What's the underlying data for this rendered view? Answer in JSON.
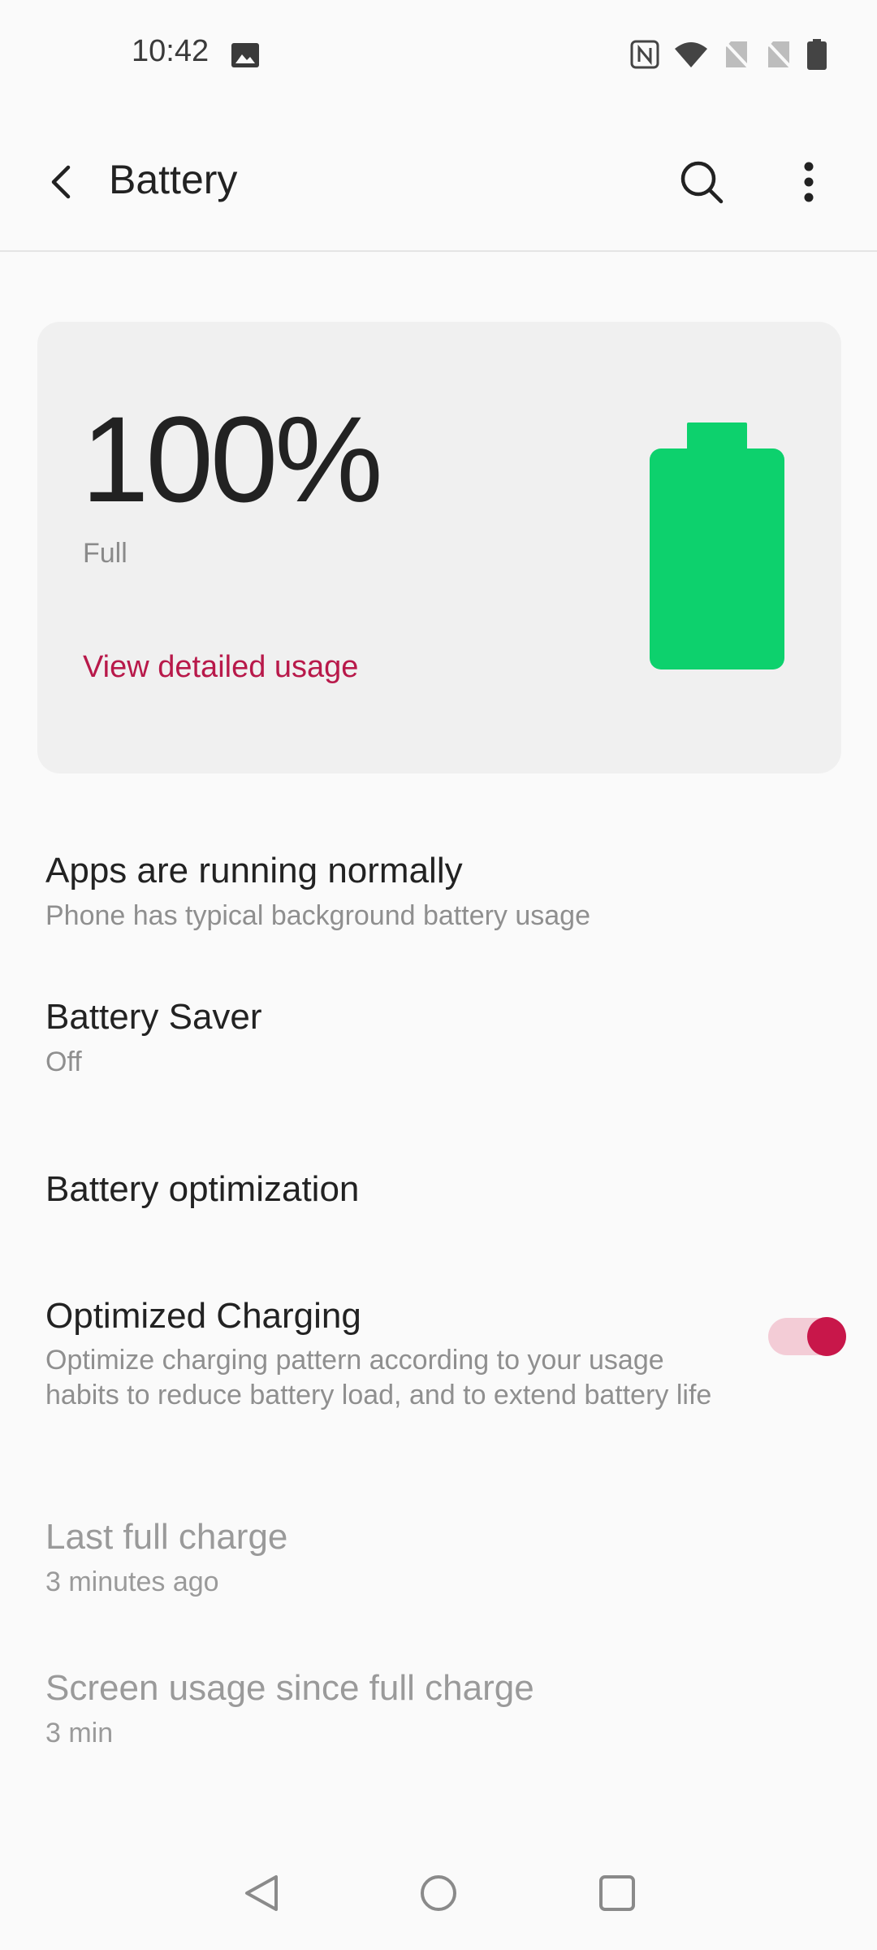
{
  "status_bar": {
    "time": "10:42",
    "left_icons": [
      "image-icon"
    ],
    "right_icons": [
      "nfc-icon",
      "wifi-icon",
      "no-sim-icon",
      "no-sim-icon",
      "battery-icon"
    ]
  },
  "app_bar": {
    "title": "Battery",
    "icons": [
      "back-arrow-icon",
      "search-icon",
      "more-vert-icon"
    ]
  },
  "battery_card": {
    "percent": "100%",
    "status": "Full",
    "link": "View detailed usage",
    "level": 1.0,
    "colors": {
      "battery": "#0dd16d",
      "link": "#b8194a",
      "card": "#f0f0f0"
    }
  },
  "items": {
    "apps_status": {
      "title": "Apps are running normally",
      "subtitle": "Phone has typical background battery usage"
    },
    "battery_saver": {
      "title": "Battery Saver",
      "subtitle": "Off"
    },
    "battery_optimization": {
      "title": "Battery optimization"
    },
    "optimized_charging": {
      "title": "Optimized Charging",
      "subtitle": "Optimize charging pattern according to your usage habits to reduce battery load, and to extend battery life",
      "toggle_on": true,
      "colors": {
        "thumb": "#c8174a",
        "track": "#f3ccd6"
      }
    },
    "last_full_charge": {
      "title": "Last full charge",
      "subtitle": "3 minutes ago"
    },
    "screen_usage": {
      "title": "Screen usage since full charge",
      "subtitle": "3 min"
    }
  },
  "nav_bar": {
    "icons": [
      "back-triangle-icon",
      "home-circle-icon",
      "recents-square-icon"
    ]
  }
}
